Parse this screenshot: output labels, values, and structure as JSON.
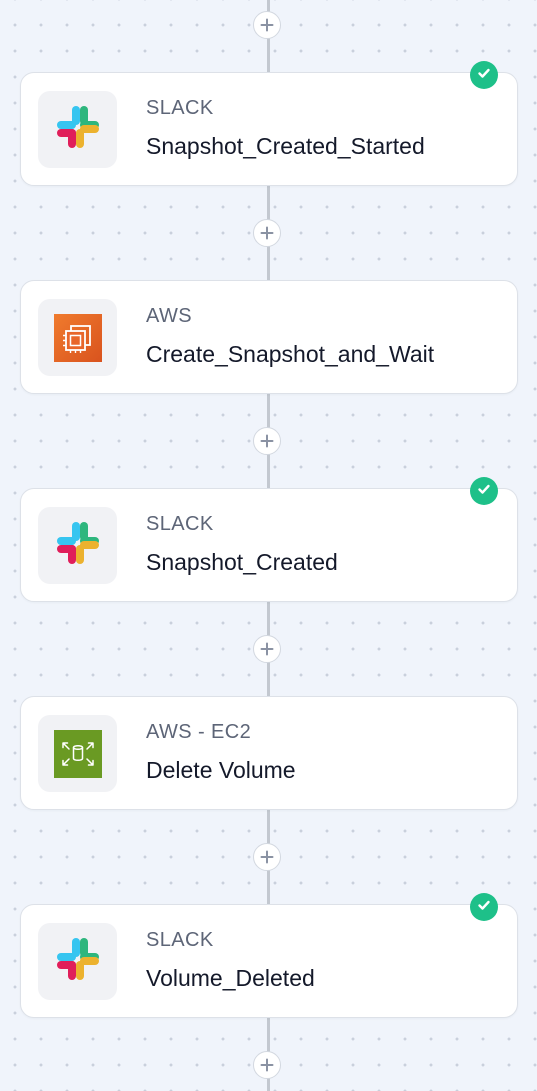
{
  "workflow": {
    "nodes": [
      {
        "provider": "SLACK",
        "title": "Snapshot_Created_Started",
        "icon": "slack-icon",
        "status": "success"
      },
      {
        "provider": "AWS",
        "title": "Create_Snapshot_and_Wait",
        "icon": "aws-compute-icon",
        "status": "none"
      },
      {
        "provider": "SLACK",
        "title": "Snapshot_Created",
        "icon": "slack-icon",
        "status": "success"
      },
      {
        "provider": "AWS - EC2",
        "title": "Delete Volume",
        "icon": "aws-ec2-volume-icon",
        "status": "none"
      },
      {
        "provider": "SLACK",
        "title": "Volume_Deleted",
        "icon": "slack-icon",
        "status": "success"
      }
    ],
    "add_step_icon": "plus-icon",
    "status_icon": "check-circle-icon"
  },
  "colors": {
    "canvas_background": "#f0f4fb",
    "connector": "#c3c8d0",
    "success": "#1ec089",
    "slack_red": "#e01e5a",
    "slack_blue": "#36c5f0",
    "slack_green": "#2eb67d",
    "slack_yellow": "#ecb22e",
    "aws_orange": "#e8662a",
    "aws_ec2_green": "#6a9a23"
  }
}
